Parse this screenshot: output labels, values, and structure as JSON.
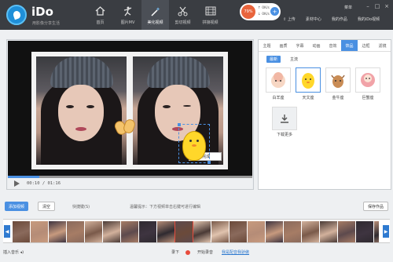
{
  "app": {
    "name": "iDo",
    "tagline": "用影像分享生活"
  },
  "nav": [
    {
      "label": "首页",
      "icon": "home-icon",
      "active": false
    },
    {
      "label": "图片MV",
      "icon": "dancer-icon",
      "active": false
    },
    {
      "label": "美化视频",
      "icon": "magic-wand-icon",
      "active": true
    },
    {
      "label": "剪切视频",
      "icon": "scissors-icon",
      "active": false
    },
    {
      "label": "拼接视频",
      "icon": "film-icon",
      "active": false
    }
  ],
  "net": {
    "percent": "79%",
    "up": "0K/s",
    "down": "0K/s"
  },
  "header_links": {
    "upload": "上传",
    "material": "素材中心",
    "mine": "我的作品",
    "mine_video": "我的iDo视频"
  },
  "menu": {
    "label": "菜单"
  },
  "player": {
    "time": "00:10 / 01:16",
    "progress": 0.13
  },
  "sticker_toolbar": {
    "done": "完成"
  },
  "panel": {
    "tabs": [
      "主题",
      "画质",
      "字幕",
      "动画",
      "音效",
      "饰品",
      "边框",
      "滤镜"
    ],
    "active_tab": 5,
    "subtabs": [
      "最新",
      "主流"
    ],
    "active_subtab": 0,
    "stickers": [
      {
        "label": "白羊座",
        "icon": "aries-sticker-icon"
      },
      {
        "label": "天文座",
        "icon": "chick-sticker-icon"
      },
      {
        "label": "金牛座",
        "icon": "taurus-sticker-icon"
      },
      {
        "label": "巨蟹座",
        "icon": "cancer-sticker-icon"
      }
    ],
    "selected_sticker": 1,
    "download_more": "下载更多"
  },
  "actions": {
    "add_video": "添加视频",
    "clear": "清空",
    "shortcut": "快捷键(S)",
    "tip": "温馨提示：下方视频单击右键可进行编辑",
    "save": "保存作品"
  },
  "bottom": {
    "music": "插入音乐",
    "record": "录下",
    "original": "开始录音",
    "help": "我是配音我骄傲"
  },
  "colors": {
    "accent": "#4a90e2",
    "topbar": "#3a3d42",
    "record": "#e84c3d"
  }
}
